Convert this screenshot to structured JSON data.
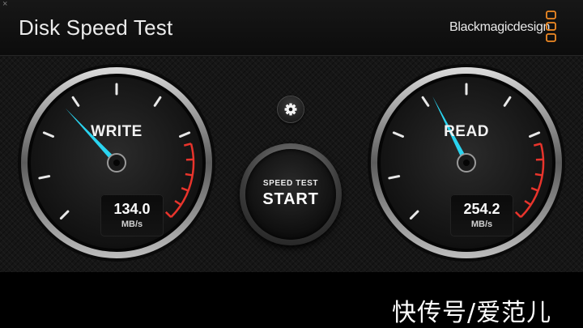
{
  "window": {
    "close_glyph": "×",
    "title": "Disk Speed Test",
    "brand": "Blackmagicdesign"
  },
  "gauges": {
    "write": {
      "label": "WRITE",
      "value": "134.0",
      "unit": "MB/s",
      "needle_fraction": 0.34
    },
    "read": {
      "label": "READ",
      "value": "254.2",
      "unit": "MB/s",
      "needle_fraction": 0.4
    }
  },
  "controls": {
    "settings_icon": "gear-icon",
    "start_small": "SPEED TEST",
    "start_big": "START"
  },
  "overlay": {
    "watermark": "快传号/爱范儿"
  },
  "colors": {
    "needle": "#2ad4f0",
    "redzone": "#e8342c",
    "brand_logo": "#f08a24"
  }
}
